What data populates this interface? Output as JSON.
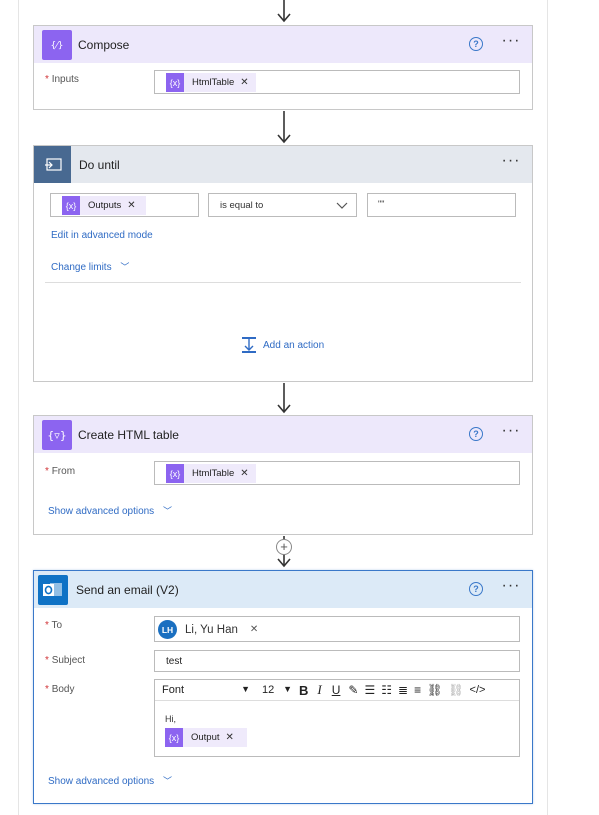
{
  "compose": {
    "title": "Compose",
    "inputs_label": "Inputs",
    "token": "HtmlTable",
    "token_icon": "{x}"
  },
  "do_until": {
    "title": "Do until",
    "left_token": "Outputs",
    "left_token_icon": "{x}",
    "operator": "is equal to",
    "value": "\"\"",
    "advanced_mode_link": "Edit in advanced mode",
    "change_limits_link": "Change limits",
    "add_action": "Add an action"
  },
  "html_table": {
    "title": "Create HTML table",
    "from_label": "From",
    "token": "HtmlTable",
    "token_icon": "{x}",
    "show_advanced": "Show advanced options"
  },
  "email": {
    "title": "Send an email (V2)",
    "to_label": "To",
    "recipient_initials": "LH",
    "recipient_name": "Li, Yu Han",
    "subject_label": "Subject",
    "subject_value": "test",
    "body_label": "Body",
    "font": "Font",
    "font_size": "12",
    "body_text": "Hi,",
    "body_token": "Output",
    "body_token_icon": "{x}",
    "show_advanced": "Show advanced options"
  },
  "colors": {
    "accent": "#3a78c9",
    "compose_purple": "#8c64f0",
    "control_slate": "#486991",
    "outlook_blue": "#0f72c5"
  }
}
